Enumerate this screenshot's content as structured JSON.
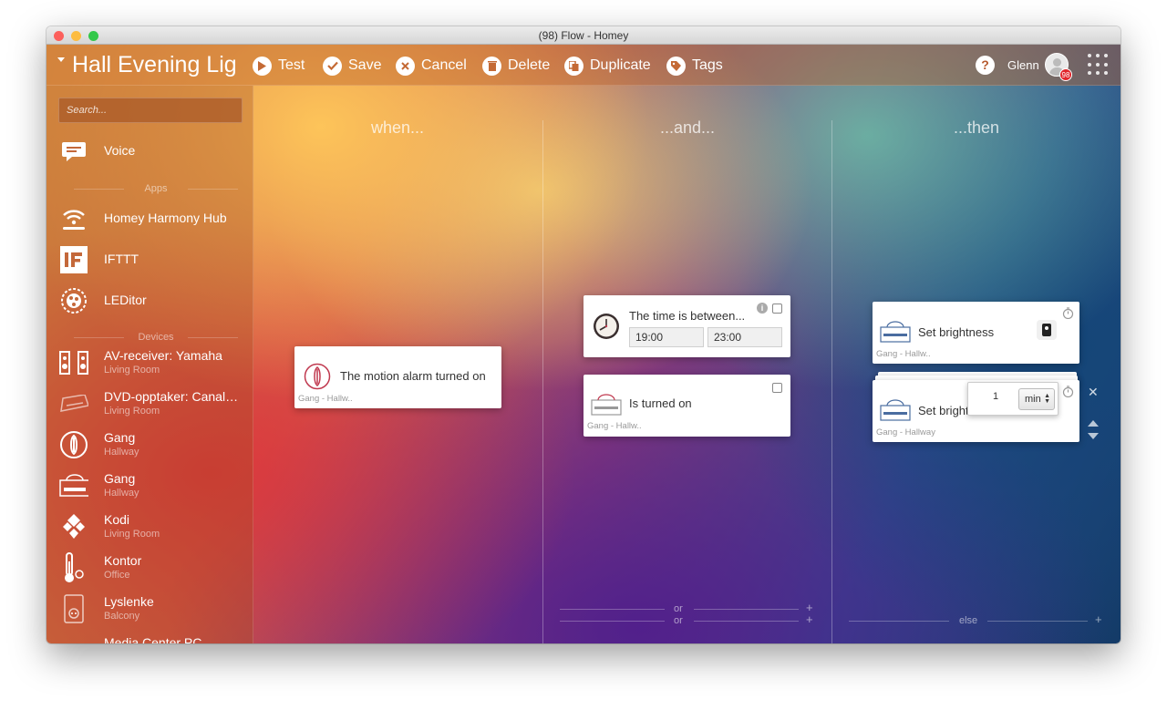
{
  "window": {
    "title": "(98) Flow - Homey"
  },
  "toolbar": {
    "flow_name": "Hall Evening Lights",
    "buttons": [
      {
        "label": "Test",
        "icon": "play-icon"
      },
      {
        "label": "Save",
        "icon": "check-icon"
      },
      {
        "label": "Cancel",
        "icon": "cancel-icon"
      },
      {
        "label": "Delete",
        "icon": "trash-icon"
      },
      {
        "label": "Duplicate",
        "icon": "duplicate-icon"
      },
      {
        "label": "Tags",
        "icon": "tag-icon"
      }
    ],
    "help": "?",
    "user": "Glenn",
    "badge": "98"
  },
  "sidebar": {
    "search_placeholder": "Search...",
    "voice": "Voice",
    "apps_header": "Apps",
    "apps": [
      {
        "name": "Homey Harmony Hub",
        "icon": "harmony-icon"
      },
      {
        "name": "IFTTT",
        "icon": "ifttt-icon"
      },
      {
        "name": "LEDitor",
        "icon": "leditor-icon"
      }
    ],
    "devices_header": "Devices",
    "devices": [
      {
        "name": "AV-receiver: Yamaha",
        "zone": "Living Room",
        "icon": "speakers-icon"
      },
      {
        "name": "DVD-opptaker: Canal Digital",
        "zone": "Living Room",
        "icon": "recorder-icon"
      },
      {
        "name": "Gang",
        "zone": "Hallway",
        "icon": "motion-sensor-icon"
      },
      {
        "name": "Gang",
        "zone": "Hallway",
        "icon": "dimmer-icon"
      },
      {
        "name": "Kodi",
        "zone": "Living Room",
        "icon": "kodi-icon"
      },
      {
        "name": "Kontor",
        "zone": "Office",
        "icon": "thermometer-icon"
      },
      {
        "name": "Lyslenke",
        "zone": "Balcony",
        "icon": "socket-icon"
      },
      {
        "name": "Media Center PC",
        "zone": "",
        "icon": "pc-icon"
      }
    ]
  },
  "columns": {
    "when": "when...",
    "and": "...and...",
    "then": "...then"
  },
  "cards": {
    "trigger": {
      "title": "The motion alarm turned on",
      "sub": "Gang - Hallw.."
    },
    "cond_time": {
      "title": "The time is between...",
      "from": "19:00",
      "to": "23:00"
    },
    "cond_on": {
      "title": "Is turned on",
      "sub": "Gang - Hallw.."
    },
    "action1": {
      "title": "Set brightness",
      "sub": "Gang - Hallw.."
    },
    "action2": {
      "title": "Set brightness",
      "sub": "Gang - Hallway",
      "delay_value": "1",
      "delay_unit": "min"
    }
  },
  "footer": {
    "or": "or",
    "else": "else",
    "plus": "+"
  },
  "colors": {
    "accent": "#b65b30",
    "badge": "#e1252b"
  }
}
